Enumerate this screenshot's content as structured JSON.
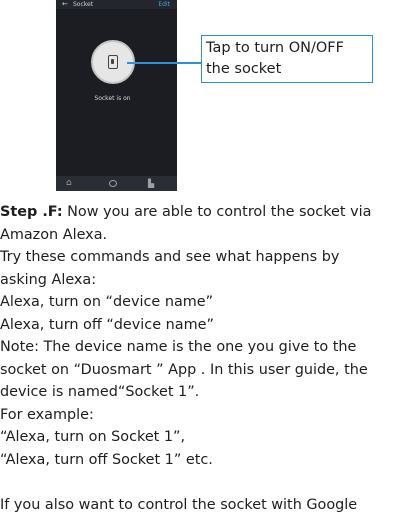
{
  "phone": {
    "header_title": "Socket",
    "header_edit": "Edit",
    "back_glyph": "←",
    "status": "Socket is on",
    "icons": [
      "plug-icon",
      "home-icon",
      "scene-icon",
      "me-icon"
    ]
  },
  "callout": "Tap to turn ON/OFF\nthe socket",
  "step": {
    "label": "Step .F:",
    "first_line_rest": " Now you are able to control the socket via"
  },
  "lines": [
    "Amazon Alexa.",
    "Try these commands and see what happens by",
    "asking Alexa:",
    "Alexa, turn on “device name”",
    "Alexa, turn off “device name”",
    "Note: The device name is the one you give to the",
    "socket on “Duosmart ” App . In this user guide, the",
    "device is named“Socket 1”.",
    "For example:",
    "“Alexa, turn on Socket 1”,",
    "“Alexa, turn off Socket 1” etc."
  ],
  "last_line": "If you also want to control the socket with Google",
  "colors": {
    "accent": "#2f8fd8",
    "phone_bg": "#1b1d22",
    "edit": "#4aa3e0"
  }
}
